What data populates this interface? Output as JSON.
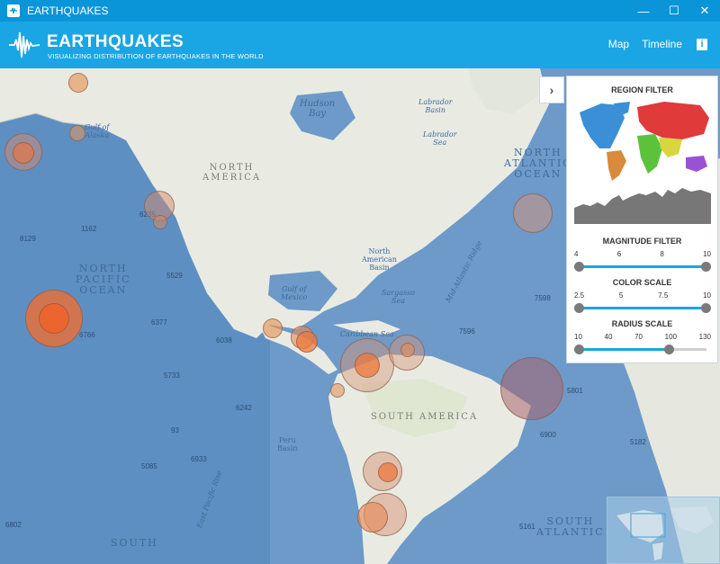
{
  "window": {
    "title": "EARTHQUAKES",
    "controls": {
      "minimize": "—",
      "maximize": "☐",
      "close": "✕"
    }
  },
  "header": {
    "brand": "EARTHQUAKES",
    "tagline": "VISUALIZING DISTRIBUTION OF EARTHQUAKES IN THE WORLD",
    "nav": {
      "map": "Map",
      "timeline": "Timeline",
      "info": "i"
    }
  },
  "map": {
    "labels": {
      "north_america": "NORTH\nAMERICA",
      "south_america": "SOUTH AMERICA",
      "north_pacific": "NORTH\nPACIFIC\nOCEAN",
      "north_atlantic": "NORTH\nATLANTIC\nOCEAN",
      "south_pacific": "SOUTH",
      "south_atlantic": "SOUTH\nATLANTIC",
      "hudson_bay": "Hudson\nBay",
      "labrador_basin": "Labrador\nBasin",
      "labrador_sea": "Labrador\nSea",
      "gulf_of_alaska": "Gulf of\nAlaska",
      "gulf_of_mexico": "Gulf of\nMexico",
      "north_american_basin": "North\nAmerican\nBasin",
      "sargasso_sea": "Sargasso\nSea",
      "caribbean_sea": "Caribbean Sea",
      "mid_atlantic_ridge": "Mid-Atlantic Ridge",
      "peru_basin": "Peru\nBasin",
      "east_pacific_rise": "East Pacific Rise"
    },
    "depths": [
      "6235",
      "8129",
      "1162",
      "5529",
      "6377",
      "6766",
      "6038",
      "5733",
      "6242",
      "93",
      "6933",
      "5085",
      "6802",
      "7598",
      "7596",
      "6900",
      "5801",
      "5182",
      "5161"
    ]
  },
  "panel": {
    "toggle_glyph": "›",
    "region_title": "REGION FILTER",
    "magnitude": {
      "title": "MAGNITUDE FILTER",
      "ticks": [
        "4",
        "6",
        "8",
        "10"
      ],
      "low": 4,
      "high": 10,
      "min": 4,
      "max": 10
    },
    "color": {
      "title": "COLOR SCALE",
      "ticks": [
        "2.5",
        "5",
        "7.5",
        "10"
      ],
      "low": 2.5,
      "high": 10,
      "min": 2.5,
      "max": 10
    },
    "radius": {
      "title": "RADIUS SCALE",
      "ticks": [
        "10",
        "40",
        "70",
        "100",
        "130"
      ],
      "low": 10,
      "high": 95,
      "min": 10,
      "max": 130
    },
    "colors": {
      "accent": "#1aa6e4",
      "north_america": "#3b8fd6",
      "south_america": "#d98a3a",
      "europe_asia": "#e03a3a",
      "africa": "#5cc23c",
      "mideast": "#d7d63c",
      "oceania": "#9a52d4"
    }
  }
}
